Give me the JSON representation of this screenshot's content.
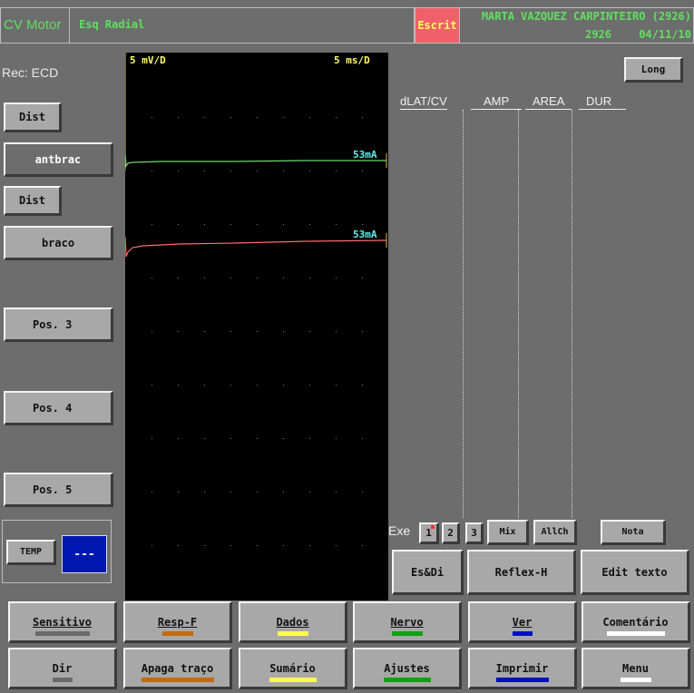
{
  "header": {
    "app_title": "CV Motor",
    "nerve": "Esq Radial",
    "escrit": "Escrit",
    "patient_name": "MARTA VAZQUEZ CARPINTEIRO (2926)",
    "patient_id": "2926",
    "date": "04/11/10"
  },
  "left_panel": {
    "rec": "Rec: ECD",
    "dist1": "Dist",
    "site1": "antbrac",
    "dist2": "Dist",
    "site2": "braco",
    "pos3": "Pos.  3",
    "pos4": "Pos.  4",
    "pos5": "Pos.  5",
    "temp": "TEMP",
    "temp_value": "---"
  },
  "trace": {
    "sensitivity": "5 mV/D",
    "sweep": "5 ms/D",
    "trace1_current": "53mA",
    "trace2_current": "53mA",
    "trace1_color": "#6fd66f",
    "trace2_color": "#ff6a6a"
  },
  "results": {
    "long_button": "Long",
    "columns": [
      "dLAT/CV",
      "AMP",
      "AREA",
      "DUR"
    ]
  },
  "exe_bar": {
    "label": "Exe",
    "b1": "1",
    "b2": "2",
    "b3": "3",
    "mix": "Mix",
    "allch": "AllCh",
    "nota": "Nota"
  },
  "actions": {
    "esdi": "Es&Di",
    "reflexh": "Reflex-H",
    "edit": "Edit texto"
  },
  "bottom": {
    "row1": [
      {
        "label": "Sensitivo",
        "color": "#6a6a6a"
      },
      {
        "label": "Resp-F",
        "color": "#c26a10"
      },
      {
        "label": "Dados",
        "color": "#ffff50"
      },
      {
        "label": "Nervo",
        "color": "#10a010"
      },
      {
        "label": "Ver",
        "color": "#0010c0"
      },
      {
        "label": "Comentário",
        "color": "#ffffff"
      }
    ],
    "row2": [
      {
        "label": "Dir",
        "color": "#6a6a6a"
      },
      {
        "label": "Apaga traço",
        "color": "#c26a10"
      },
      {
        "label": "Sumário",
        "color": "#ffff50"
      },
      {
        "label": "Ajustes",
        "color": "#10a010"
      },
      {
        "label": "Imprimir",
        "color": "#0010c0"
      },
      {
        "label": "Menu",
        "color": "#ffffff"
      }
    ]
  }
}
